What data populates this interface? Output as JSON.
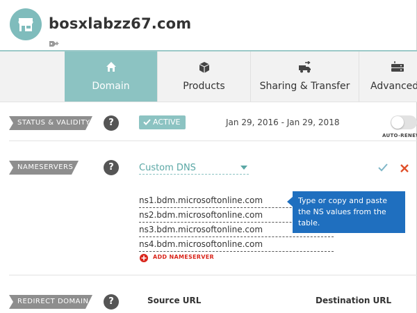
{
  "header": {
    "domain": "bosxlabzz67.com"
  },
  "nav": {
    "tabs": [
      {
        "label": "Domain",
        "icon": "home-icon"
      },
      {
        "label": "Products",
        "icon": "box-icon"
      },
      {
        "label": "Sharing & Transfer",
        "icon": "truck-transfer-icon"
      },
      {
        "label": "Advanced",
        "icon": "server-icon"
      }
    ],
    "active_tab": "Domain"
  },
  "status": {
    "label": "STATUS & VALIDITY",
    "help": "?",
    "badge": "ACTIVE",
    "validity": "Jan 29, 2016 - Jan 29, 2018",
    "autorenew_label": "AUTO-RENEW",
    "autorenew_on": false
  },
  "nameservers": {
    "label": "NAMESERVERS",
    "help": "?",
    "dns_type": "Custom DNS",
    "entries": [
      "ns1.bdm.microsoftonline.com",
      "ns2.bdm.microsoftonline.com",
      "ns3.bdm.microsoftonline.com",
      "ns4.bdm.microsoftonline.com"
    ],
    "add_label": "ADD NAMESERVER",
    "tooltip": "Type or copy and paste the NS values from the table."
  },
  "redirect": {
    "label": "REDIRECT DOMAIN",
    "help": "?",
    "source_header": "Source URL",
    "destination_header": "Destination URL"
  },
  "colors": {
    "accent": "#8cc3c2",
    "save_check": "#7fb6c8",
    "cancel_x": "#e0502a",
    "add_red": "#d9261c",
    "tooltip_blue": "#1f6fbf"
  }
}
